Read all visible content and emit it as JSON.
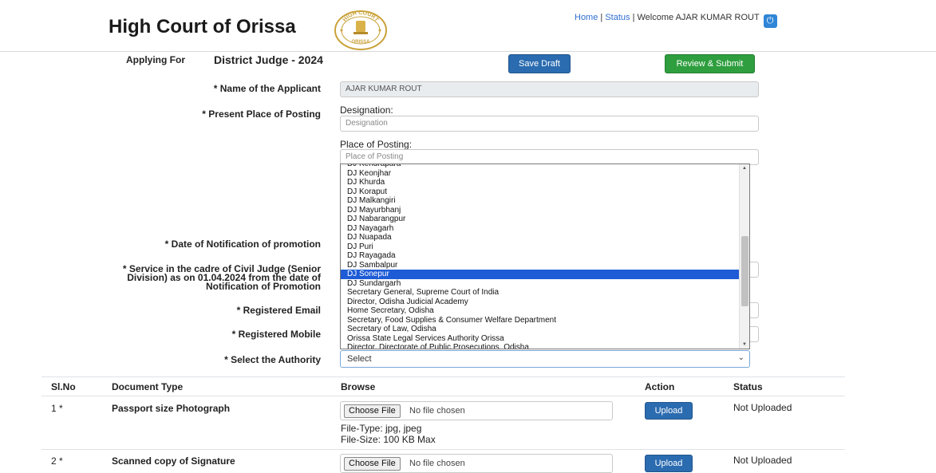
{
  "header": {
    "site_title": "High Court of Orissa",
    "links": {
      "home": "Home",
      "sep1": " | ",
      "status": "Status",
      "sep2": " | ",
      "welcome": "Welcome AJAR KUMAR ROUT"
    },
    "logo": {
      "text_top": "HIGH COURT",
      "text_bottom": "ORISSA"
    }
  },
  "form": {
    "applying_label": "Applying For",
    "applying_value": "District Judge - 2024",
    "save_draft": "Save Draft",
    "review_submit": "Review & Submit",
    "name_label": "* Name of the Applicant",
    "name_value": "AJAR KUMAR ROUT",
    "posting_label": "* Present Place of Posting",
    "designation_label": "Designation:",
    "designation_placeholder": "Designation",
    "place_label": "Place of Posting:",
    "place_placeholder": "Place of Posting",
    "notification_label": "* Date of Notification of promotion",
    "service_label_1": "* Service in the cadre of Civil Judge (Senior",
    "service_label_2": "Division) as on 01.04.2024 from the date of",
    "service_label_3": "Notification of Promotion",
    "email_label": "* Registered Email",
    "mobile_label": "* Registered Mobile",
    "authority_label": "* Select the Authority",
    "authority_value": "Select"
  },
  "dropdown": {
    "items": [
      "DJ Kendrapara",
      "DJ Keonjhar",
      "DJ Khurda",
      "DJ Koraput",
      "DJ Malkangiri",
      "DJ Mayurbhanj",
      "DJ Nabarangpur",
      "DJ Nayagarh",
      "DJ Nuapada",
      "DJ Puri",
      "DJ Rayagada",
      "DJ Sambalpur",
      "DJ Sonepur",
      "DJ Sundargarh",
      "Secretary General, Supreme Court of India",
      "Director, Odisha Judicial Academy",
      "Home Secretary, Odisha",
      "Secretary, Food Supplies & Consumer Welfare Department",
      "Secretary of Law, Odisha",
      "Orissa State Legal Services Authority Orissa",
      "Director, Directorate of Public Prosecutions, Odisha"
    ],
    "selected_index": 12
  },
  "table": {
    "headers": {
      "slno": "Sl.No",
      "doctype": "Document Type",
      "browse": "Browse",
      "action": "Action",
      "status": "Status"
    },
    "rows": [
      {
        "slno": "1 *",
        "doctype": "Passport size Photograph",
        "choose": "Choose File",
        "nofile": "No file chosen",
        "filetype": "File-Type: jpg, jpeg",
        "filesize": "File-Size: 100 KB Max",
        "upload": "Upload",
        "status": "Not Uploaded"
      },
      {
        "slno": "2 *",
        "doctype": "Scanned copy of Signature",
        "choose": "Choose File",
        "nofile": "No file chosen",
        "upload": "Upload",
        "status": "Not Uploaded"
      }
    ]
  },
  "colors": {
    "primary": "#2b6cb0",
    "success": "#2e9e3e",
    "link": "#2f6fd1",
    "selected": "#1e5bd6"
  }
}
